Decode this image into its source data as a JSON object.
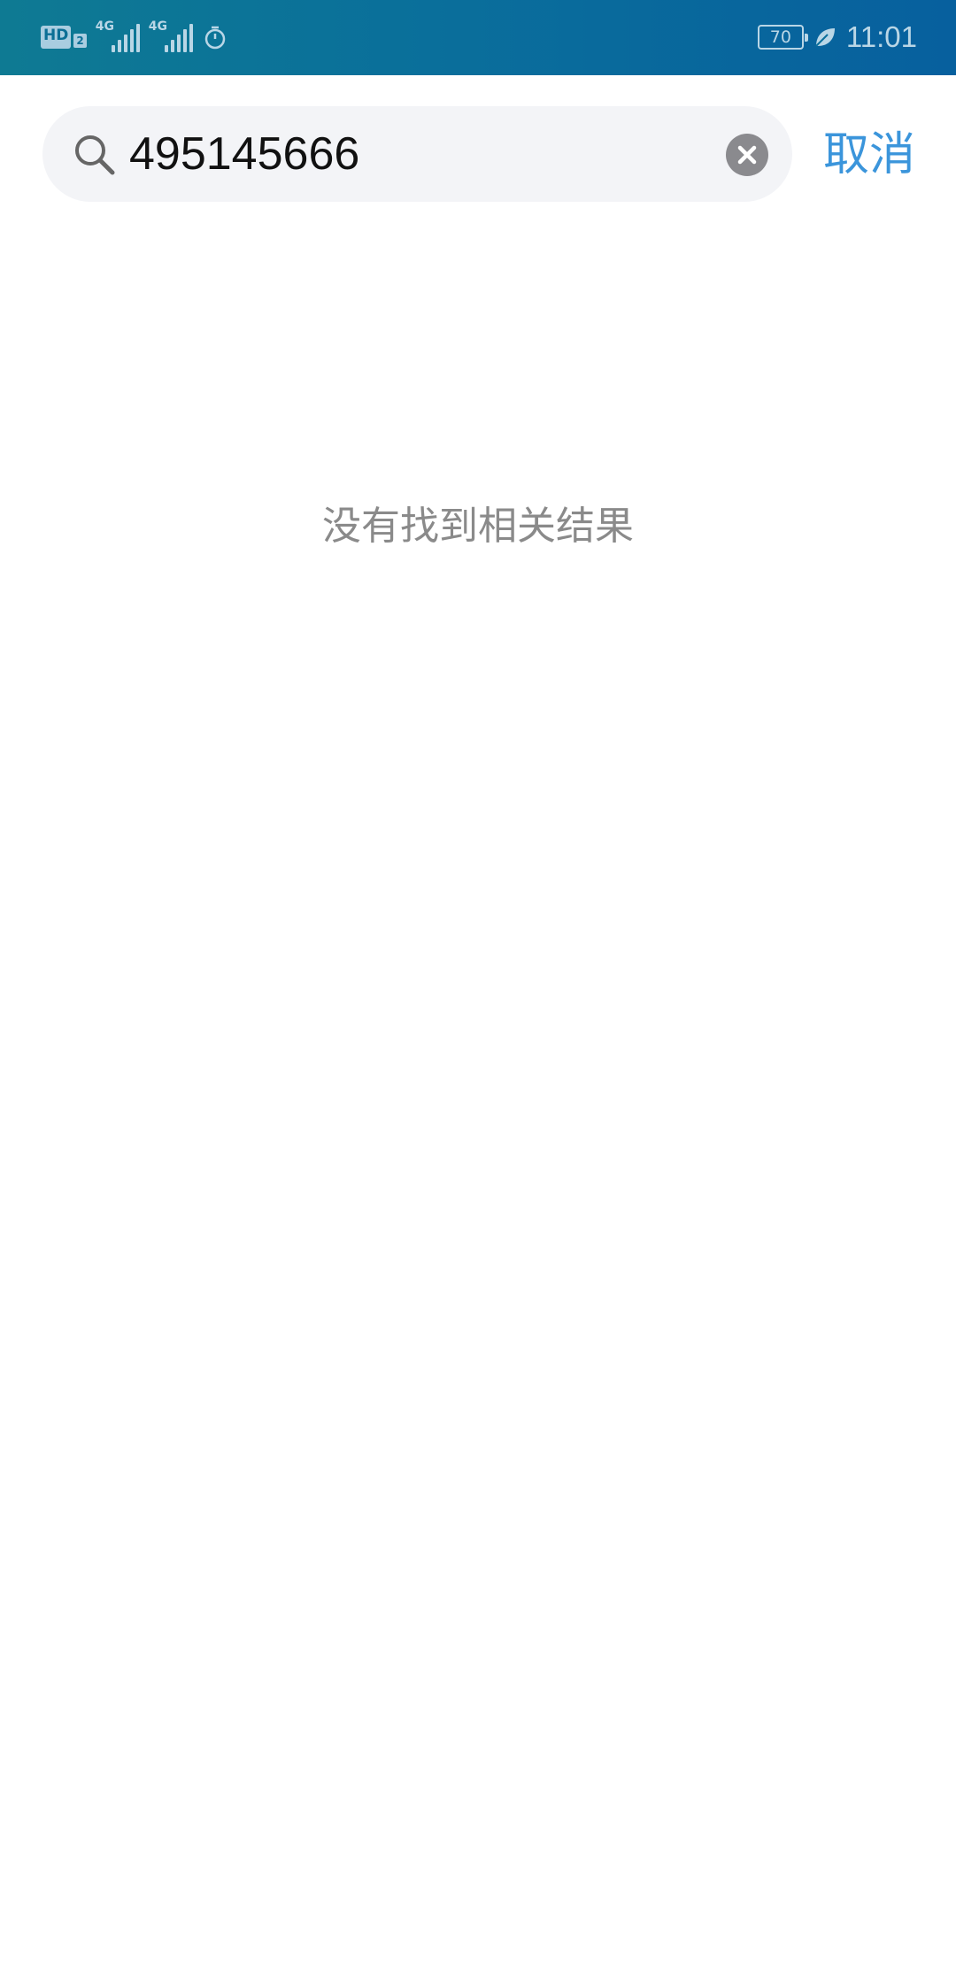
{
  "status_bar": {
    "hd_label": "HD",
    "hd_sub": "2",
    "signal_1_tag": "4G",
    "signal_2_tag": "4G",
    "battery_level": "70",
    "time": "11:01",
    "icons": [
      "hd-icon",
      "signal-icon",
      "signal-icon",
      "timer-icon",
      "battery-icon",
      "leaf-icon"
    ]
  },
  "search": {
    "value": "495145666",
    "cancel_label": "取消"
  },
  "results": {
    "empty_message": "没有找到相关结果"
  },
  "colors": {
    "status_bar_start": "#0e7a93",
    "status_bar_end": "#07609e",
    "accent": "#3b95db",
    "search_bg": "#f3f4f7"
  }
}
